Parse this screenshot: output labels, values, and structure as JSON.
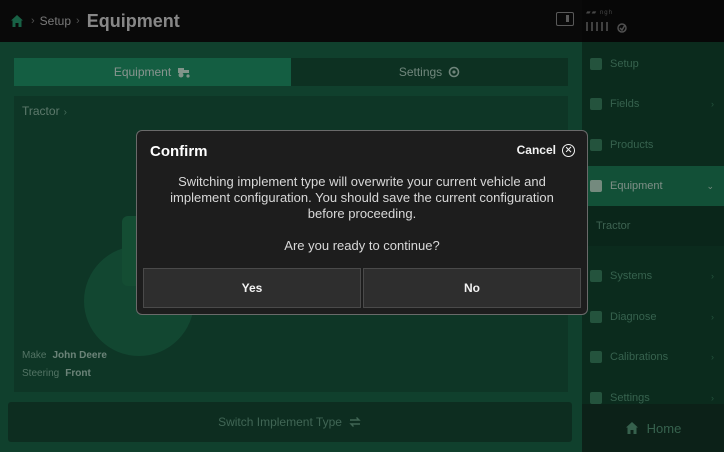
{
  "header": {
    "breadcrumb_parent": "Setup",
    "breadcrumb_sep": "›",
    "title": "Equipment"
  },
  "main": {
    "tabs": [
      {
        "label": "Equipment",
        "icon": "tractor-icon",
        "active": true
      },
      {
        "label": "Settings",
        "icon": "gear-icon",
        "active": false
      }
    ],
    "panel_title": "Tractor",
    "panel_chevron": "›",
    "make_label": "Make",
    "make_value": "John Deere",
    "steering_label": "Steering",
    "steering_value": "Front",
    "switch_label": "Switch Implement Type"
  },
  "sidebar": {
    "items": [
      {
        "label": "Setup",
        "icon": "setup-icon"
      },
      {
        "label": "Fields",
        "icon": "fields-icon",
        "arrow": "›"
      },
      {
        "label": "Products",
        "icon": "products-icon"
      },
      {
        "label": "Equipment",
        "icon": "tractor-icon",
        "arrow": "⌄",
        "active": true
      },
      {
        "label": "Systems",
        "icon": "systems-icon",
        "arrow": "›"
      },
      {
        "label": "Diagnose",
        "icon": "diagnose-icon",
        "arrow": "›"
      },
      {
        "label": "Calibrations",
        "icon": "calibrations-icon",
        "arrow": "›"
      },
      {
        "label": "Settings",
        "icon": "gear-icon",
        "arrow": "›"
      }
    ],
    "sub_item": "Tractor",
    "home_label": "Home",
    "status_text": "▰▰ ngh"
  },
  "modal": {
    "title": "Confirm",
    "cancel_label": "Cancel",
    "message": "Switching implement type will overwrite your current vehicle and implement configuration.  You should save the current configuration before proceeding.",
    "question": "Are you ready to continue?",
    "yes_label": "Yes",
    "no_label": "No"
  },
  "colors": {
    "accent": "#23a273",
    "panel": "#1d6f4e",
    "modal_bg": "#1d1d1d"
  }
}
